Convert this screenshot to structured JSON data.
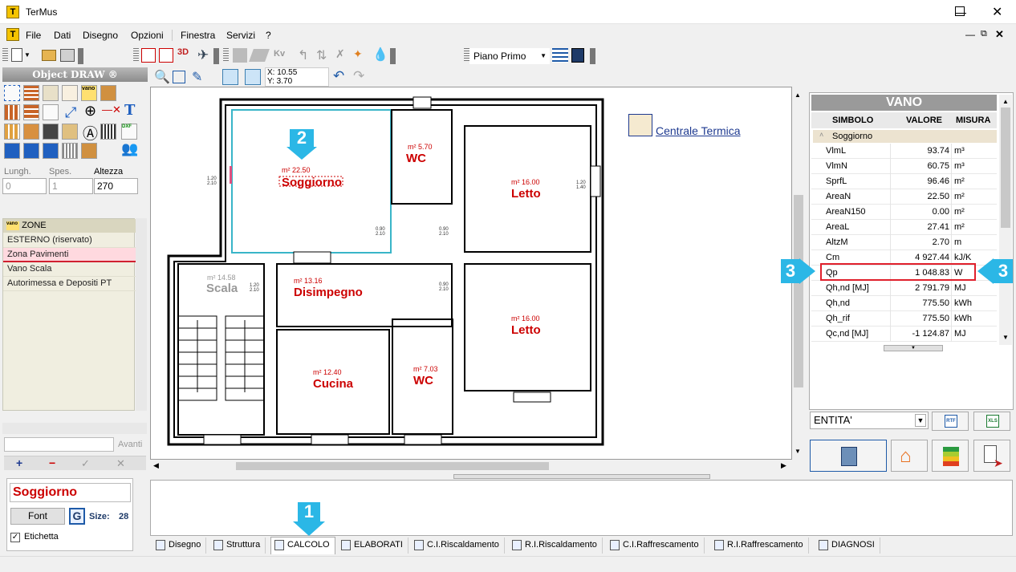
{
  "window": {
    "title": "TerMus"
  },
  "menu": [
    "File",
    "Dati",
    "Disegno",
    "Opzioni",
    "Finestra",
    "Servizi",
    "?"
  ],
  "toolbar": {
    "floor_select": "Piano Primo"
  },
  "coords": {
    "x": "X: 10.55",
    "y": "Y: 3.70"
  },
  "object_draw": {
    "title": "Object DRAW ®",
    "lungh_label": "Lungh.",
    "spes_label": "Spes.",
    "altezza_label": "Altezza",
    "lungh_value": "0",
    "spes_value": "1",
    "altezza_value": "270"
  },
  "zones": {
    "header": "ZONE",
    "items": [
      "ESTERNO (riservato)",
      "Zona Pavimenti",
      "Vano Scala",
      "Autorimessa e Depositi PT"
    ],
    "selected": "Zona Pavimenti",
    "search_btn": "Avanti"
  },
  "label_panel": {
    "text": "Soggiorno",
    "font_btn": "Font",
    "g_btn": "G",
    "size_label": "Size:",
    "size_value": "28",
    "etichetta": "Etichetta"
  },
  "rooms": [
    {
      "area": "m² 22.50",
      "name": "Soggiorno"
    },
    {
      "area": "m² 5.70",
      "name": "WC"
    },
    {
      "area": "m² 16.00",
      "name": "Letto"
    },
    {
      "area": "m² 14.58",
      "name": "Scala"
    },
    {
      "area": "m² 13.16",
      "name": "Disimpegno"
    },
    {
      "area": "m² 16.00",
      "name": "Letto"
    },
    {
      "area": "m² 12.40",
      "name": "Cucina"
    },
    {
      "area": "m² 7.03",
      "name": "WC"
    }
  ],
  "door_labels": [
    "1.20",
    "2.10",
    "0.90",
    "0.90",
    "2.10",
    "0.90",
    "1.20",
    "1.40",
    "1.20",
    "1.40"
  ],
  "centrale": "Centrale Termica",
  "vano": {
    "title": "VANO",
    "col_symbol": "SIMBOLO",
    "col_value": "VALORE",
    "col_unit": "MISURA",
    "group": "Soggiorno",
    "rows": [
      {
        "sym": "VlmL",
        "val": "93.74",
        "unit": "m³"
      },
      {
        "sym": "VlmN",
        "val": "60.75",
        "unit": "m³"
      },
      {
        "sym": "SprfL",
        "val": "96.46",
        "unit": "m²"
      },
      {
        "sym": "AreaN",
        "val": "22.50",
        "unit": "m²"
      },
      {
        "sym": "AreaN150",
        "val": "0.00",
        "unit": "m²"
      },
      {
        "sym": "AreaL",
        "val": "27.41",
        "unit": "m²"
      },
      {
        "sym": "AltzM",
        "val": "2.70",
        "unit": "m"
      },
      {
        "sym": "Cm",
        "val": "4 927.44",
        "unit": "kJ/K"
      },
      {
        "sym": "Qp",
        "val": "1 048.83",
        "unit": "W"
      },
      {
        "sym": "Qh,nd [MJ]",
        "val": "2 791.79",
        "unit": "MJ"
      },
      {
        "sym": "Qh,nd",
        "val": "775.50",
        "unit": "kWh"
      },
      {
        "sym": "Qh_rif",
        "val": "775.50",
        "unit": "kWh"
      },
      {
        "sym": "Qc,nd [MJ]",
        "val": "-1 124.87",
        "unit": "MJ"
      }
    ],
    "highlight": "Qp",
    "entity_select": "ENTITA'"
  },
  "tabs": [
    "Disegno",
    "Struttura",
    "CALCOLO",
    "ELABORATI",
    "C.I.Riscaldamento",
    "R.I.Riscaldamento",
    "C.I.Raffrescamento",
    "R.I.Raffrescamento",
    "DIAGNOSI"
  ],
  "active_tab": "CALCOLO",
  "badges": [
    "2",
    "3",
    "3",
    "1"
  ],
  "colors": {
    "accent_cyan": "#2bb7e6",
    "room_text": "#cc0000",
    "highlight_red": "#e0202c",
    "selected_zone": "#ffd9df"
  }
}
